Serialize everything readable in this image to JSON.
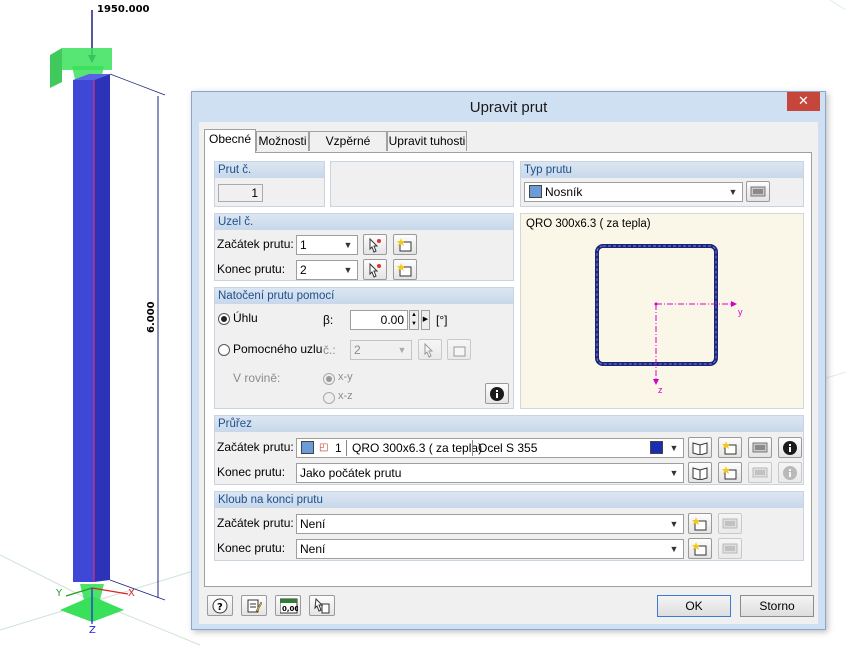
{
  "viewport": {
    "load_value": "1950.000",
    "length_value": "6.000",
    "axis_labels": {
      "y": "Y",
      "x": "X",
      "z": "Z"
    }
  },
  "dialog": {
    "title": "Upravit prut",
    "close_label": "✕",
    "tabs": [
      "Obecné",
      "Možnosti",
      "Vzpěrné délky",
      "Upravit tuhosti"
    ],
    "member_no": {
      "header": "Prut č.",
      "value": "1"
    },
    "member_type": {
      "header": "Typ prutu",
      "value": "Nosník",
      "color": "#6b9bd8"
    },
    "nodes": {
      "header": "Uzel č.",
      "start_label": "Začátek prutu:",
      "start_value": "1",
      "end_label": "Konec prutu:",
      "end_value": "2"
    },
    "rotation": {
      "header": "Natočení prutu pomocí",
      "angle_label": "Úhlu",
      "beta_label": "β:",
      "beta_value": "0.00",
      "beta_unit": "[°]",
      "helper_node_label": "Pomocného uzlu",
      "node_no_label": "č.:",
      "node_no_value": "2",
      "plane_label": "V rovině:",
      "plane_xy": "x-y",
      "plane_xz": "x-z"
    },
    "section_preview": {
      "title": "QRO 300x6.3 ( za tepla)",
      "axis_y": "y",
      "axis_z": "z"
    },
    "cross_section": {
      "header": "Průřez",
      "start_label": "Začátek prutu:",
      "start_no": "1",
      "start_section": "QRO 300x6.3 ( za tepla)",
      "start_material": "Ocel S 355",
      "end_label": "Konec prutu:",
      "end_value": "Jako počátek prutu",
      "section_color": "#6b9bd8",
      "material_color": "#1a2cb0"
    },
    "hinge": {
      "header": "Kloub na konci prutu",
      "start_label": "Začátek prutu:",
      "start_value": "Není",
      "end_label": "Konec prutu:",
      "end_value": "Není"
    },
    "buttons": {
      "ok": "OK",
      "cancel": "Storno"
    },
    "icons": {
      "units": "0,00"
    }
  }
}
